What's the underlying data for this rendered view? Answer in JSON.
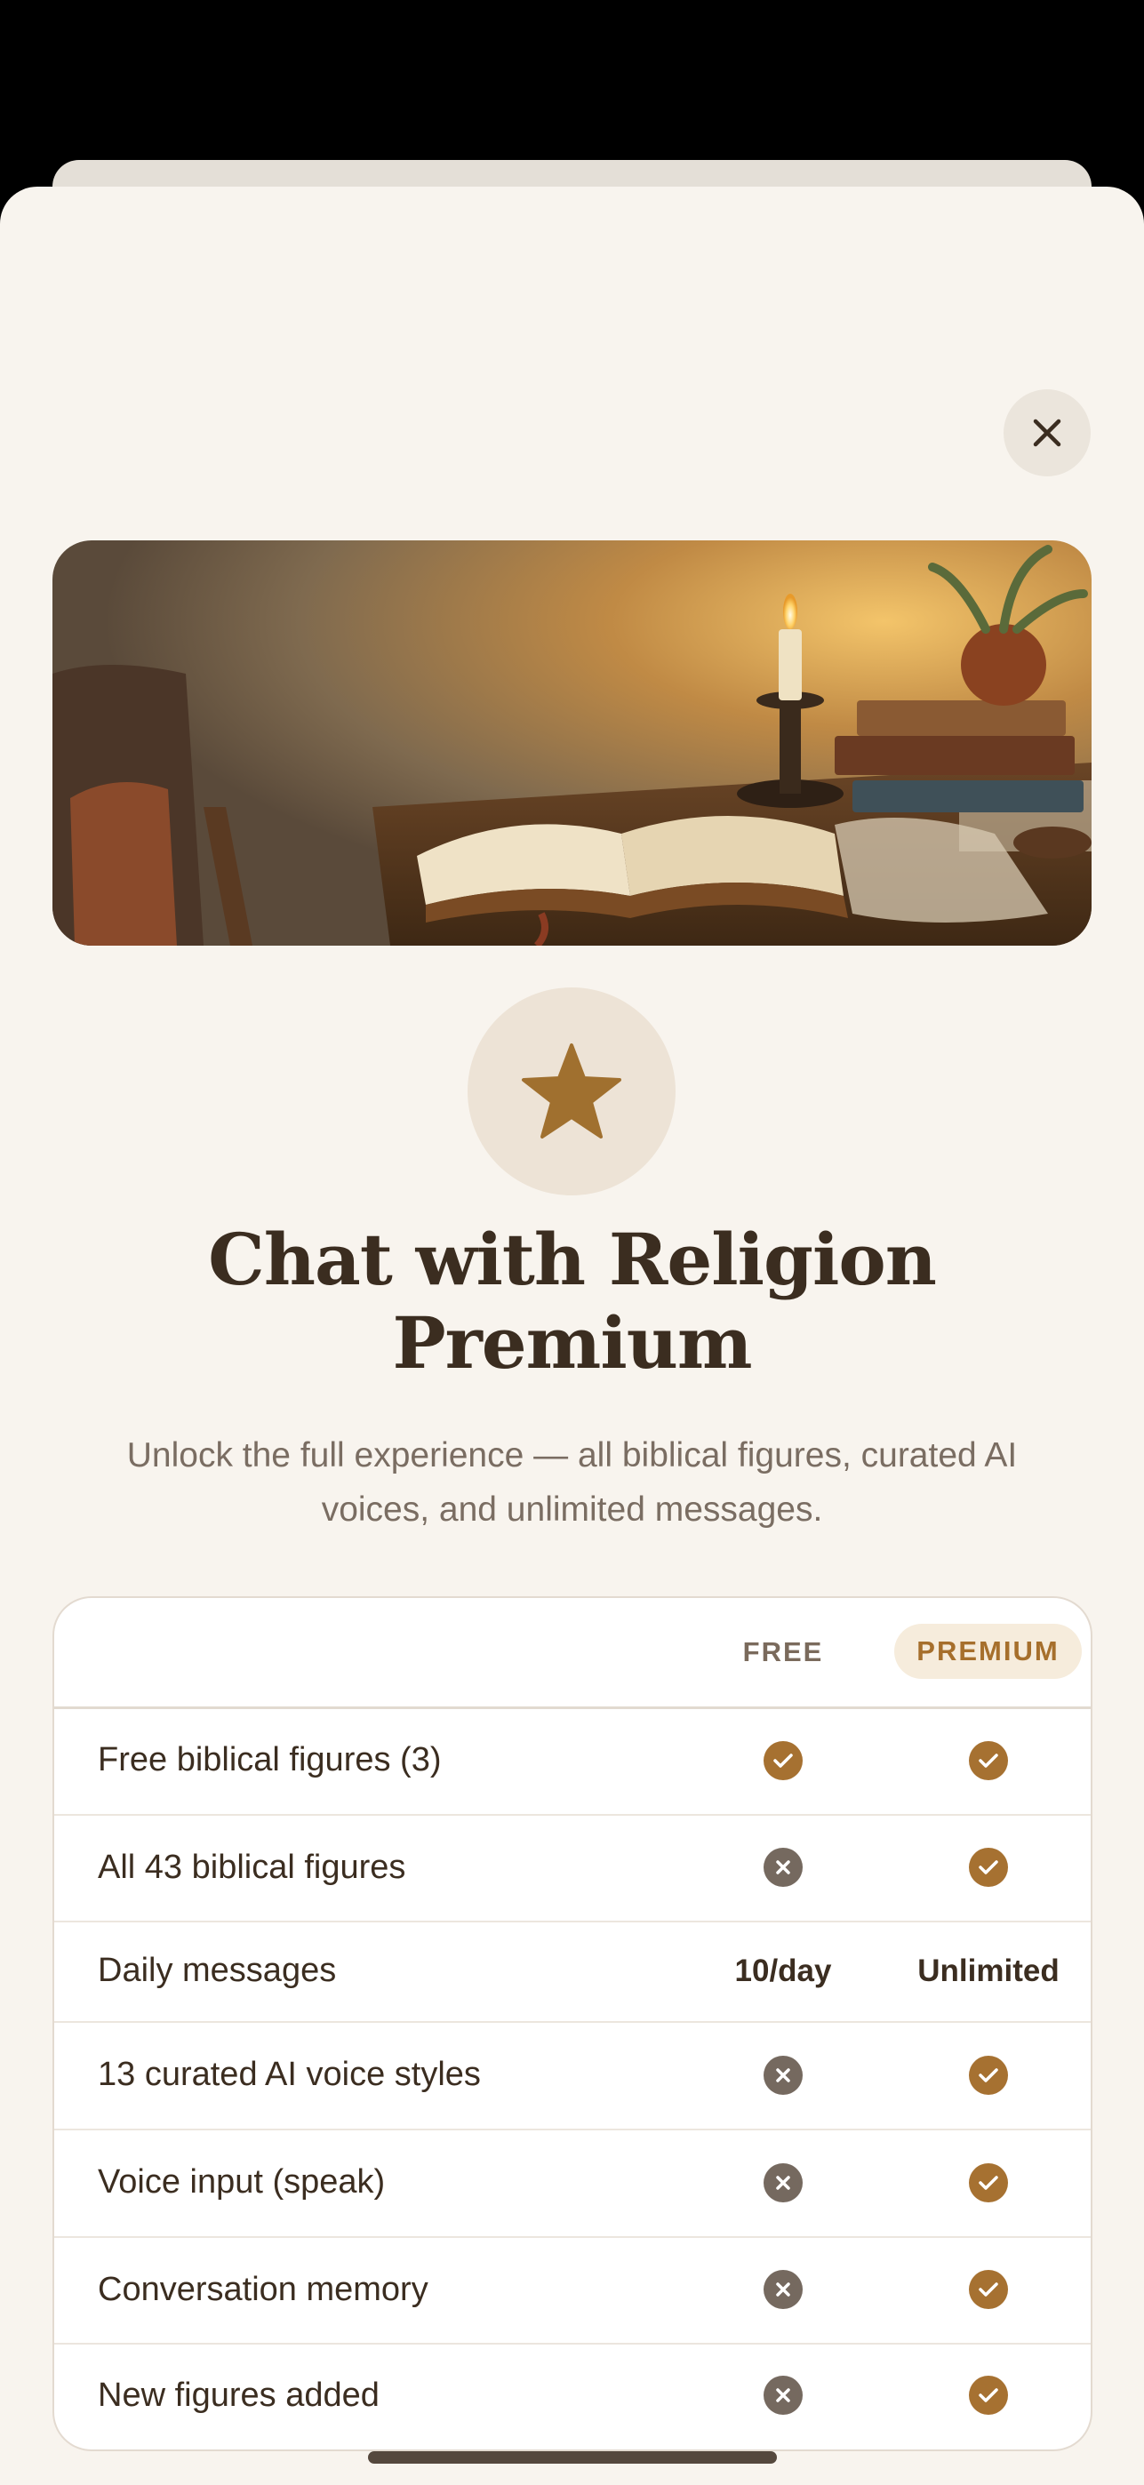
{
  "modal": {
    "title_line1": "Chat with Religion",
    "title_line2": "Premium",
    "subtitle": "Unlock the full experience — all biblical figures, curated AI voices, and unlimited messages."
  },
  "icons": {
    "close": "close-icon",
    "badge": "star-icon",
    "included": "check-icon",
    "excluded": "x-icon"
  },
  "colors": {
    "accent": "#a67131",
    "background": "#f8f4ee",
    "title_text": "#3b2d20",
    "excluded_icon": "#75695f"
  },
  "comparison": {
    "columns": {
      "free": "FREE",
      "premium": "PREMIUM"
    },
    "rows": [
      {
        "label": "Free biblical figures (3)",
        "free": "check",
        "premium": "check"
      },
      {
        "label": "All 43 biblical figures",
        "free": "x",
        "premium": "check"
      },
      {
        "label": "Daily messages",
        "free": "10/day",
        "premium": "Unlimited"
      },
      {
        "label": "13 curated AI voice styles",
        "free": "x",
        "premium": "check"
      },
      {
        "label": "Voice input (speak)",
        "free": "x",
        "premium": "check"
      },
      {
        "label": "Conversation memory",
        "free": "x",
        "premium": "check"
      },
      {
        "label": "New figures added",
        "free": "x",
        "premium": "check"
      }
    ]
  }
}
